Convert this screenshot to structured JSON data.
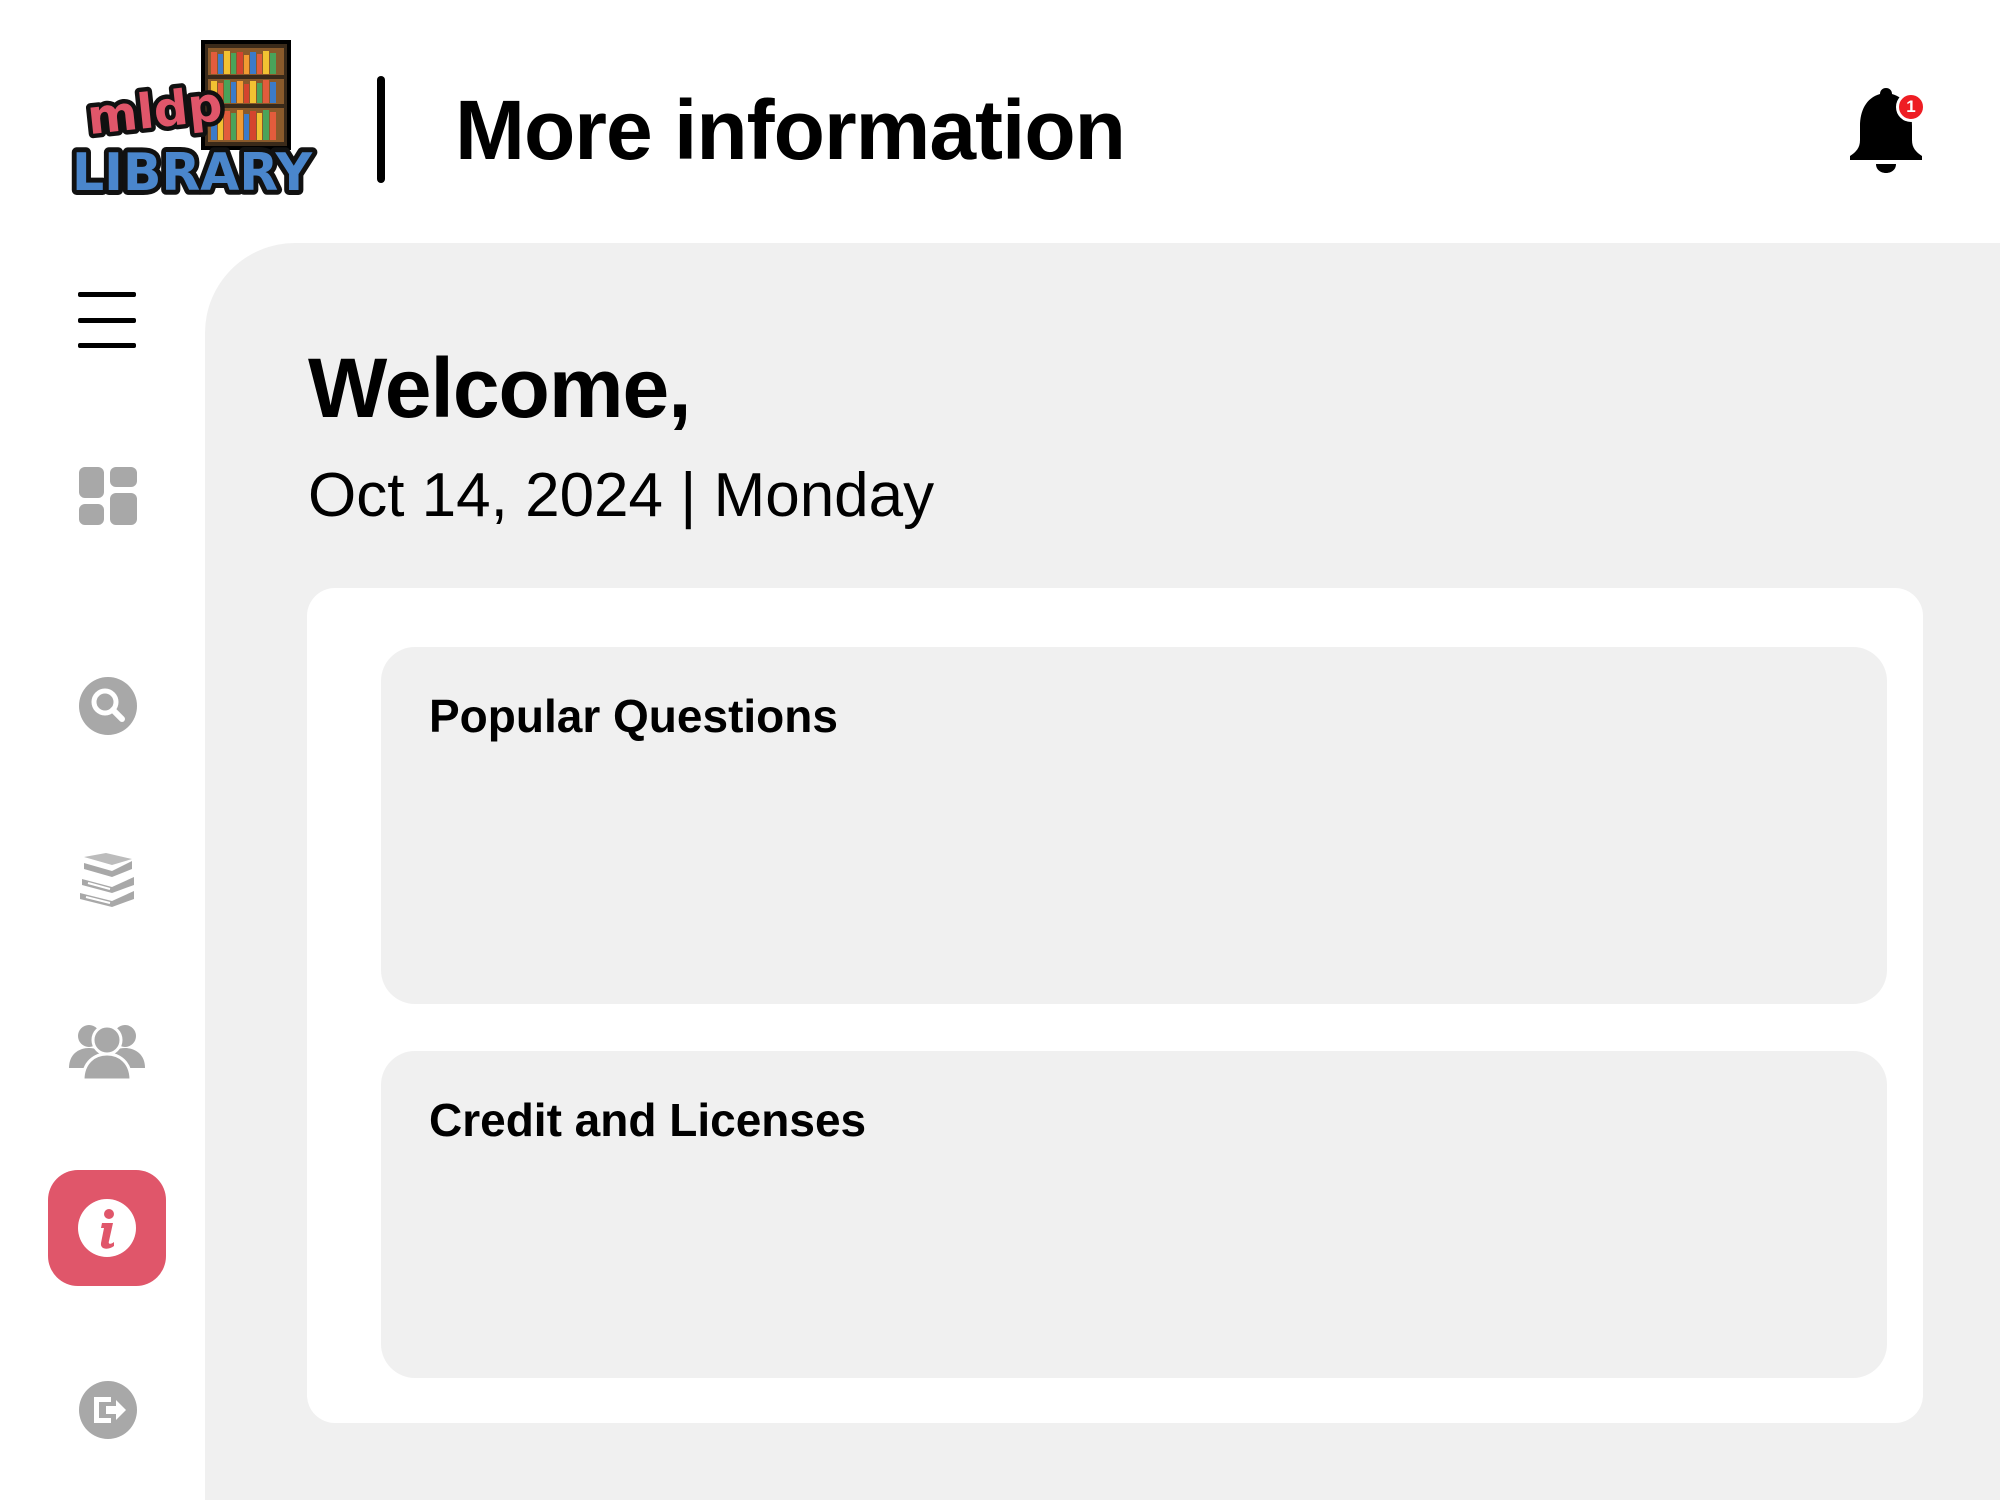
{
  "header": {
    "logo": {
      "name": "mldp-library-logo",
      "line1": "mldp",
      "line2": "LIBRARY"
    },
    "title": "More information",
    "notifications": {
      "icon": "bell-icon",
      "count": "1"
    }
  },
  "sidebar": {
    "items": [
      {
        "id": "menu",
        "icon": "hamburger-menu-icon"
      },
      {
        "id": "dashboard",
        "icon": "dashboard-grid-icon"
      },
      {
        "id": "search",
        "icon": "search-icon"
      },
      {
        "id": "books",
        "icon": "books-stack-icon"
      },
      {
        "id": "users",
        "icon": "users-group-icon"
      },
      {
        "id": "info",
        "icon": "info-icon",
        "active": true
      },
      {
        "id": "logout",
        "icon": "logout-icon"
      }
    ],
    "active_color": "#e0566a",
    "inactive_color": "#a8a8a8"
  },
  "main": {
    "welcome": "Welcome,",
    "date_line": "Oct 14, 2024 | Monday",
    "sections": [
      {
        "title": "Popular Questions"
      },
      {
        "title": "Credit and Licenses"
      }
    ]
  }
}
